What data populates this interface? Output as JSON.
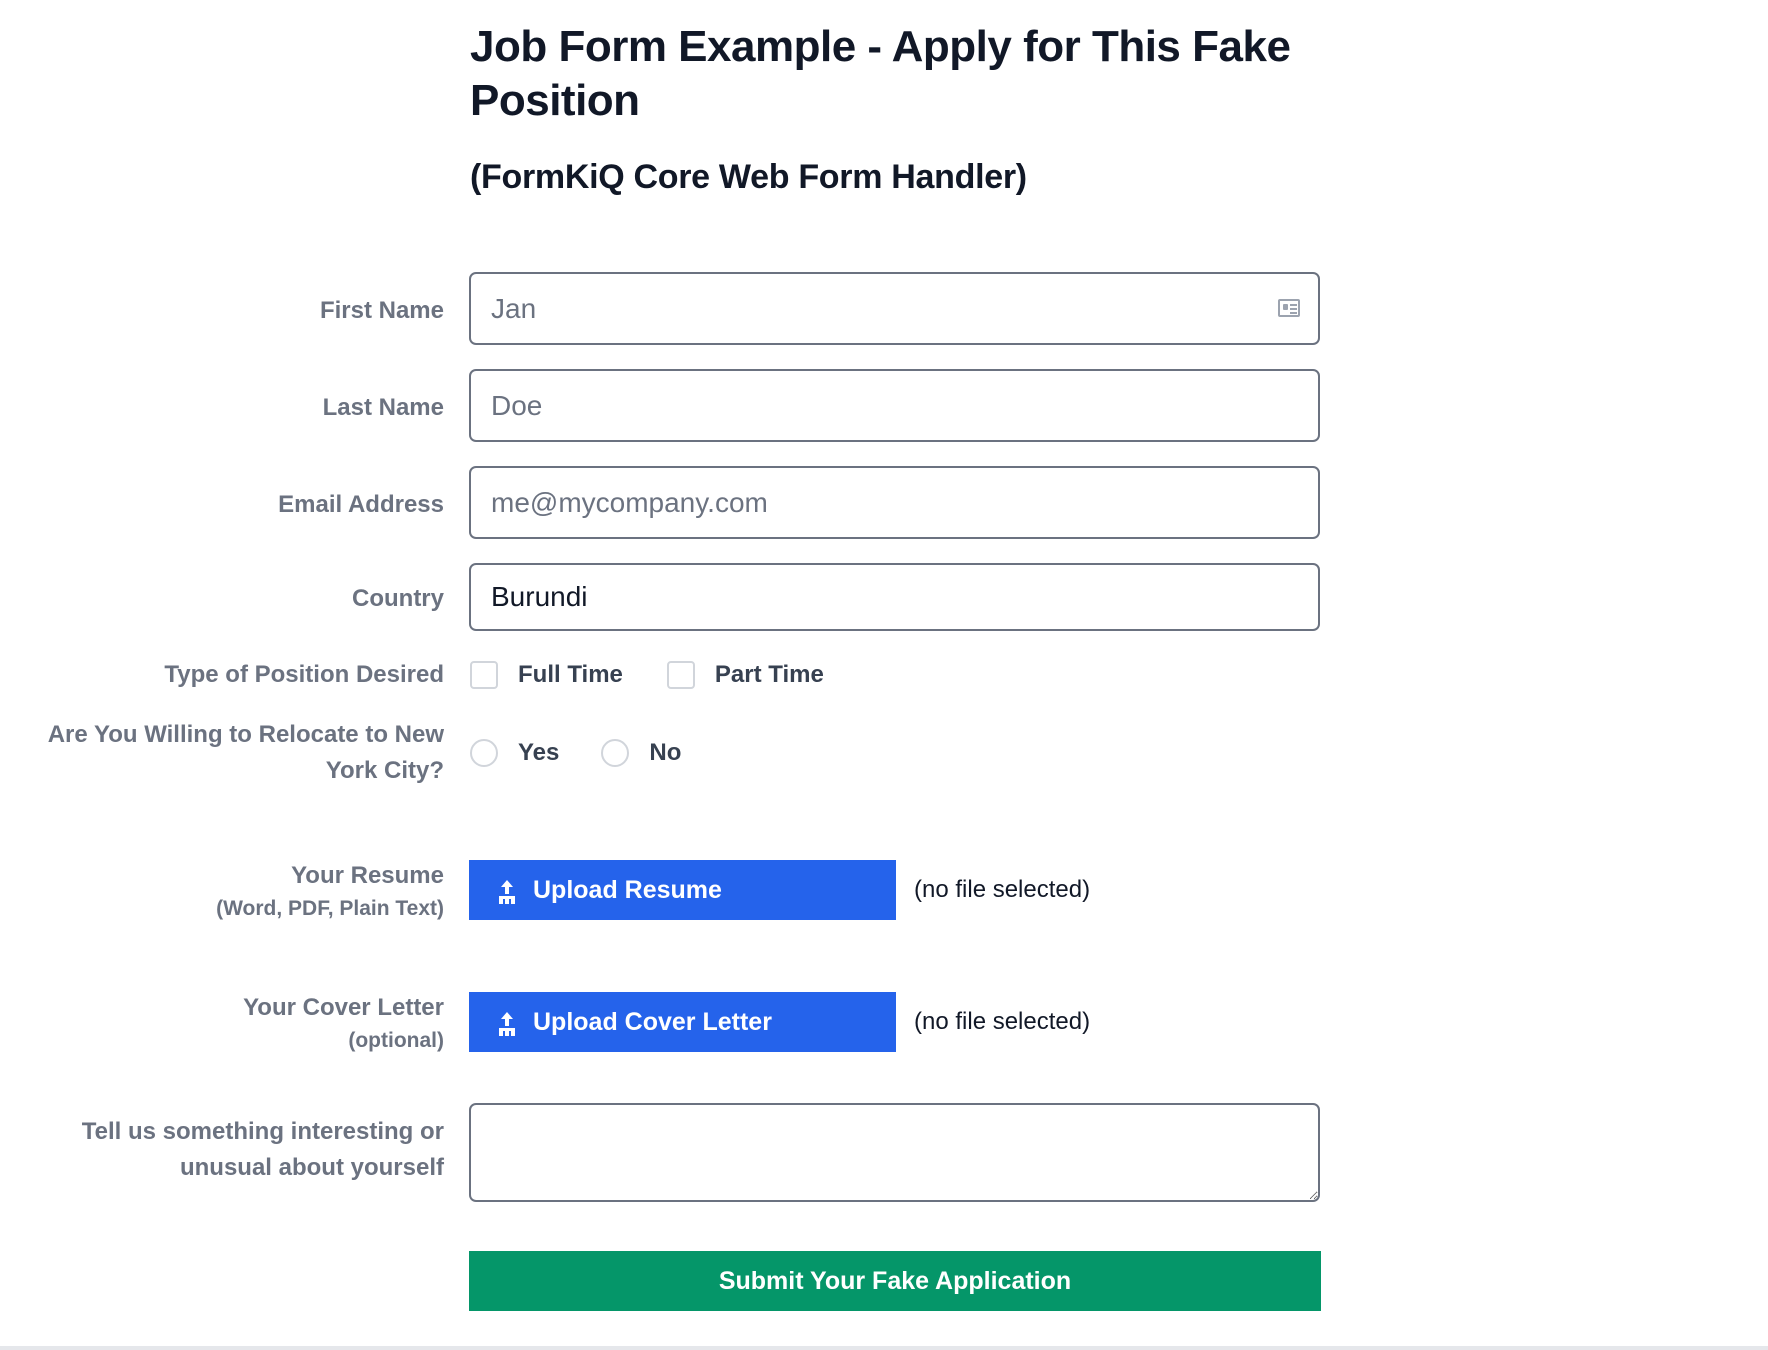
{
  "header": {
    "title": "Job Form Example - Apply for This Fake Position",
    "subtitle": "(FormKiQ Core Web Form Handler)"
  },
  "form": {
    "first_name": {
      "label": "First Name",
      "placeholder": "Jan",
      "icon": "contact-card-icon"
    },
    "last_name": {
      "label": "Last Name",
      "placeholder": "Doe"
    },
    "email": {
      "label": "Email Address",
      "placeholder": "me@mycompany.com"
    },
    "country": {
      "label": "Country",
      "value": "Burundi"
    },
    "position_type": {
      "label": "Type of Position Desired",
      "options": [
        "Full Time",
        "Part Time"
      ]
    },
    "relocate": {
      "label": "Are You Willing to Relocate to New York City?",
      "options": [
        "Yes",
        "No"
      ]
    },
    "resume": {
      "label": "Your Resume",
      "sublabel": "(Word, PDF, Plain Text)",
      "button_label": "Upload Resume",
      "status": "(no file selected)",
      "icon": "upload-icon"
    },
    "cover_letter": {
      "label": "Your Cover Letter",
      "sublabel": "(optional)",
      "button_label": "Upload Cover Letter",
      "status": "(no file selected)",
      "icon": "upload-icon"
    },
    "interesting": {
      "label": "Tell us something interesting or unusual about yourself"
    },
    "submit_label": "Submit Your Fake Application"
  },
  "colors": {
    "upload_button": "#2563eb",
    "submit_button": "#059669",
    "label_text": "#6b7280"
  }
}
